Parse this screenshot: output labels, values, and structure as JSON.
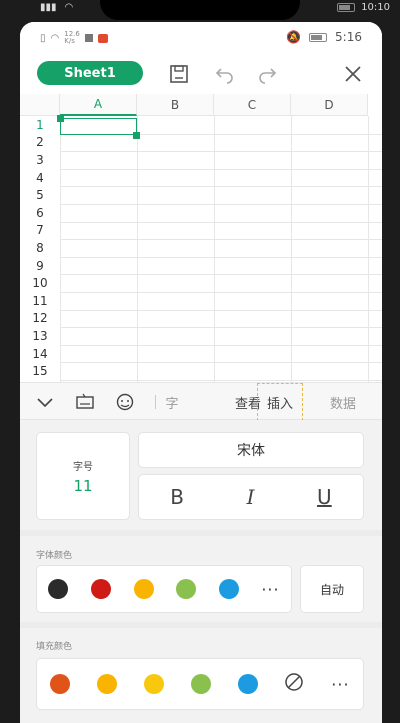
{
  "outer_status": {
    "right_time": "10:10"
  },
  "status": {
    "net_speed_top": "12.6",
    "net_speed_bottom": "K/s",
    "time": "5:16"
  },
  "toolbar": {
    "sheet_label": "Sheet1"
  },
  "grid": {
    "columns": [
      "A",
      "B",
      "C",
      "D"
    ],
    "rows": [
      "1",
      "2",
      "3",
      "4",
      "5",
      "6",
      "7",
      "8",
      "9",
      "10",
      "11",
      "12",
      "13",
      "14",
      "15"
    ]
  },
  "tabs": {
    "partial_label": "字",
    "view": "查看",
    "insert": "插入",
    "data": "数据"
  },
  "font_panel": {
    "size_label": "字号",
    "size_value": "11",
    "font_name": "宋体",
    "bold": "B",
    "italic": "I",
    "underline": "U"
  },
  "font_color": {
    "title": "字体颜色",
    "auto_label": "自动",
    "more": "···",
    "swatches": [
      "#2b2b2b",
      "#d01a15",
      "#f8b400",
      "#8ac04d",
      "#1c9be0"
    ]
  },
  "fill_color": {
    "title": "填充颜色",
    "more": "···",
    "swatches": [
      "#e0541a",
      "#f8b400",
      "#f8c80f",
      "#8ac04d",
      "#1c9be0"
    ]
  },
  "accent_color": "#16a168"
}
